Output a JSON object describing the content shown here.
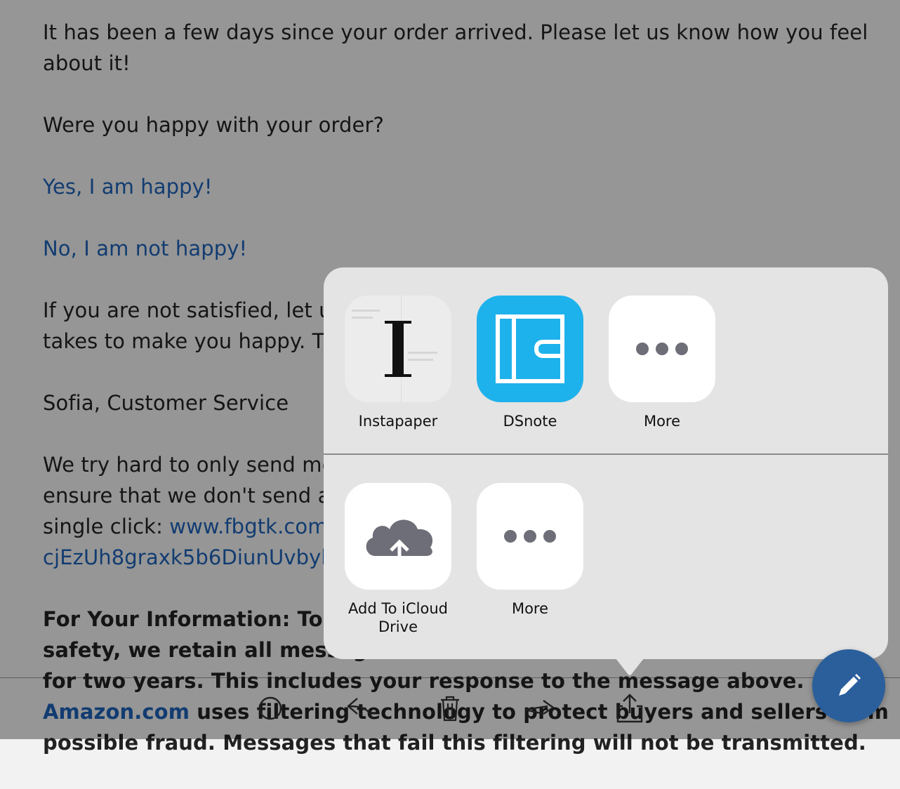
{
  "email": {
    "para1": [
      "It has been a few days since your order arrived. Please let us know how you feel",
      "about it!"
    ],
    "question": "Were you happy with your order?",
    "yes_link": "Yes, I am happy!",
    "no_link": "No, I am not happy!",
    "para_unsatisfied": [
      "If you are not satisfied, let us",
      "takes to make you happy. Tha"
    ],
    "signature": "Sofia, Customer Service",
    "para_try": [
      "We try hard to only send mes",
      "ensure that we don't send an",
      "single click: "
    ],
    "unsubscribe_link_1": "www.fbgtk.com//",
    "unsubscribe_link_2": "cjEzUh8graxk5b6DiunUvbykC",
    "fyi_bold": [
      "For Your Information: To he",
      "safety, we retain all messag",
      "for two years. This includes your response to the message above."
    ],
    "amazon_link": "Amazon.com",
    "fyi_rest": " uses filtering technology to protect buyers and sellers from",
    "fyi_last": "possible fraud. Messages that fail this filtering will not be transmitted."
  },
  "share_sheet": {
    "row1": [
      {
        "label": "Instapaper",
        "icon": "instapaper-icon"
      },
      {
        "label": "DSnote",
        "icon": "dsnote-icon"
      },
      {
        "label": "More",
        "icon": "more-dots-icon"
      }
    ],
    "row2": [
      {
        "label": "Add To iCloud Drive",
        "icon": "icloud-upload-icon"
      },
      {
        "label": "More",
        "icon": "more-dots-icon"
      }
    ]
  },
  "toolbar": {
    "items": [
      "circle-icon",
      "reply-icon",
      "trash-icon",
      "forward-icon",
      "share-icon"
    ]
  },
  "fab": {
    "icon": "compose-pencil-icon",
    "color": "#2a5f9c"
  },
  "colors": {
    "link": "#1d62b6",
    "dsnote_blue": "#1eb2ec",
    "sheet_bg": "#e4e4e4"
  }
}
